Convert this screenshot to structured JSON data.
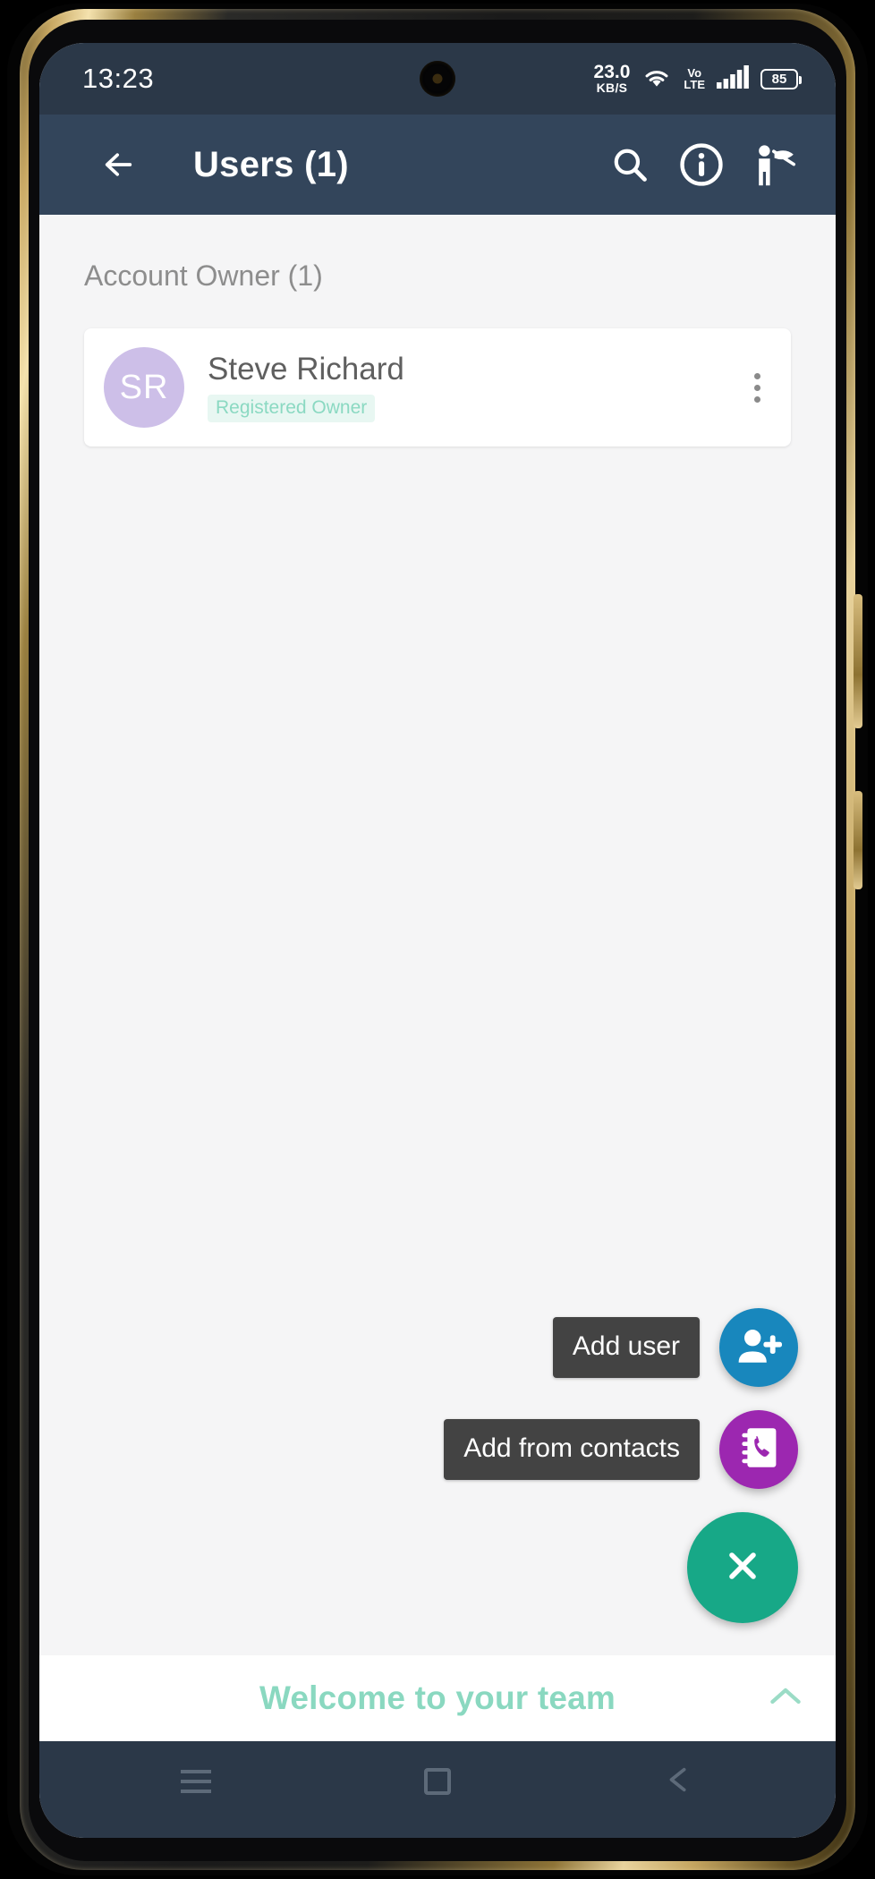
{
  "status_bar": {
    "clock": "13:23",
    "net_speed_value": "23.0",
    "net_speed_unit": "KB/S",
    "volte_top": "Vo",
    "volte_bottom": "LTE",
    "battery_level": "85",
    "icons": [
      "wifi-icon",
      "volte-icon",
      "signal-bars-icon",
      "battery-icon"
    ],
    "background_color": "#2b3848"
  },
  "app_bar": {
    "back_icon": "arrow-left-icon",
    "title": "Users (1)",
    "actions": [
      {
        "icon": "search-icon",
        "name": "search-button"
      },
      {
        "icon": "info-circle-icon",
        "name": "info-button"
      },
      {
        "icon": "person-add-contact-icon",
        "name": "invite-user-button"
      }
    ],
    "background_color": "#33455b"
  },
  "main": {
    "section_label": "Account Owner (1)",
    "users": [
      {
        "initials": "SR",
        "name": "Steve Richard",
        "role_badge": "Registered Owner",
        "avatar_color": "#cdbfe8",
        "badge_color": "#8bd9c2",
        "menu_icon": "more-vertical-icon"
      }
    ]
  },
  "fab_menu": {
    "expanded": true,
    "items": [
      {
        "label": "Add user",
        "icon": "person-add-icon",
        "color": "#1887bd",
        "name": "fab-add-user"
      },
      {
        "label": "Add from contacts",
        "icon": "contact-book-icon",
        "color": "#9c27b0",
        "name": "fab-add-from-contacts"
      }
    ],
    "close_button": {
      "icon": "close-icon",
      "color": "#17a887",
      "name": "fab-close"
    }
  },
  "bottom_banner": {
    "text": "Welcome to your team",
    "text_color": "#8ad8c0",
    "chevron_icon": "chevron-up-icon"
  },
  "nav_bar": {
    "buttons": [
      {
        "icon": "menu-recents-icon",
        "name": "nav-recents"
      },
      {
        "icon": "home-square-icon",
        "name": "nav-home"
      },
      {
        "icon": "back-triangle-icon",
        "name": "nav-back"
      }
    ],
    "background_color": "#2b3848"
  }
}
